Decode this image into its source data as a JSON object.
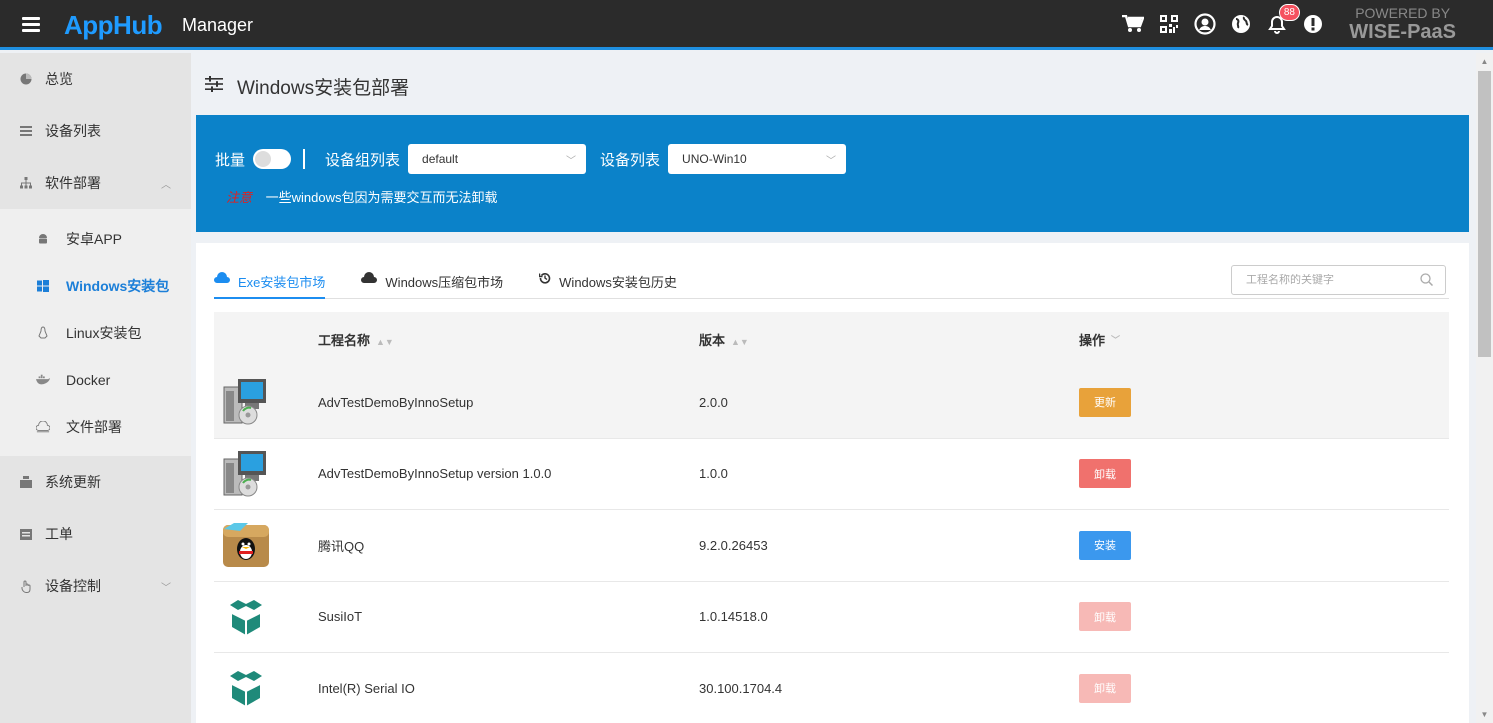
{
  "header": {
    "brand": "AppHub",
    "subtitle": "Manager",
    "notification_count": "88",
    "powered_line1": "POWERED BY",
    "powered_line2": "WISE-PaaS",
    "icons": [
      "cart-icon",
      "qrcode-icon",
      "user-icon",
      "globe-icon",
      "bell-icon",
      "alert-icon"
    ]
  },
  "sidebar": {
    "items": [
      {
        "label": "总览",
        "icon": "pie-chart-icon"
      },
      {
        "label": "设备列表",
        "icon": "list-icon"
      },
      {
        "label": "软件部署",
        "icon": "sitemap-icon"
      },
      {
        "label": "系统更新",
        "icon": "update-icon"
      },
      {
        "label": "工单",
        "icon": "calendar-icon"
      },
      {
        "label": "设备控制",
        "icon": "hand-icon"
      }
    ],
    "sub_items": [
      {
        "label": "安卓APP",
        "icon": "android-icon"
      },
      {
        "label": "Windows安装包",
        "icon": "windows-icon"
      },
      {
        "label": "Linux安装包",
        "icon": "linux-icon"
      },
      {
        "label": "Docker",
        "icon": "docker-icon"
      },
      {
        "label": "文件部署",
        "icon": "cloud-icon"
      }
    ]
  },
  "page": {
    "title": "Windows安装包部署"
  },
  "filters": {
    "batch_label": "批量",
    "group_label": "设备组列表",
    "group_value": "default",
    "device_label": "设备列表",
    "device_value": "UNO-Win10",
    "notice_tag": "注意",
    "notice_text": "一些windows包因为需要交互而无法卸载"
  },
  "tabs": [
    {
      "label": "Exe安装包市场"
    },
    {
      "label": "Windows压缩包市场"
    },
    {
      "label": "Windows安装包历史"
    }
  ],
  "search": {
    "placeholder": "工程名称的关键字"
  },
  "table": {
    "headers": {
      "name": "工程名称",
      "version": "版本",
      "action": "操作"
    },
    "rows": [
      {
        "name": "AdvTestDemoByInnoSetup",
        "version": "2.0.0",
        "action": "更新",
        "icon": "installer-icon"
      },
      {
        "name": "AdvTestDemoByInnoSetup version 1.0.0",
        "version": "1.0.0",
        "action": "卸载",
        "icon": "installer-icon"
      },
      {
        "name": "腾讯QQ",
        "version": "9.2.0.26453",
        "action": "安装",
        "icon": "qq-icon"
      },
      {
        "name": "SusiIoT",
        "version": "1.0.14518.0",
        "action": "卸载",
        "icon": "box-icon"
      },
      {
        "name": "Intel(R) Serial IO",
        "version": "30.100.1704.4",
        "action": "卸载",
        "icon": "box-icon"
      }
    ]
  },
  "colors": {
    "accent": "#1c8df0",
    "panel": "#0b82c9",
    "update": "#e8a23a",
    "uninstall": "#f0716d",
    "install": "#3b98ee"
  }
}
